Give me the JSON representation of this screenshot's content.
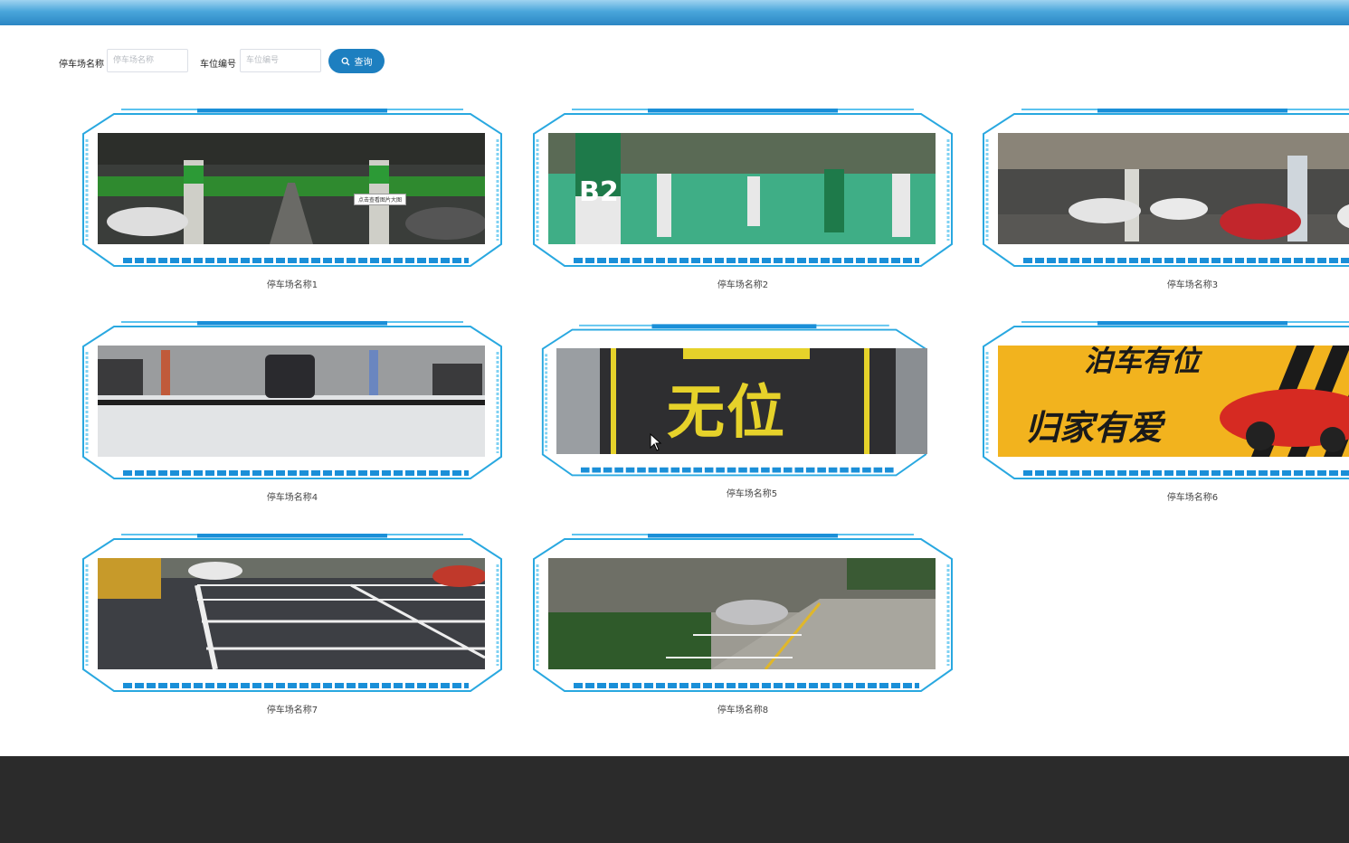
{
  "search": {
    "name_label": "停车场名称",
    "name_placeholder": "停车场名称",
    "code_label": "车位编号",
    "code_placeholder": "车位编号",
    "query_label": "查询"
  },
  "cards": [
    {
      "caption": "停车场名称1",
      "tooltip": "点击查看图片大图"
    },
    {
      "caption": "停车场名称2",
      "sign": "B2"
    },
    {
      "caption": "停车场名称3"
    },
    {
      "caption": "停车场名称4"
    },
    {
      "caption": "停车场名称5",
      "paint_text": "无位"
    },
    {
      "caption": "停车场名称6",
      "line1": "泊车有位",
      "line2": "归家有爱"
    },
    {
      "caption": "停车场名称7"
    },
    {
      "caption": "停车场名称8"
    }
  ],
  "colors": {
    "accent": "#1d7fc0",
    "frame": "#29a8e0",
    "footer": "#2b2b2b"
  }
}
